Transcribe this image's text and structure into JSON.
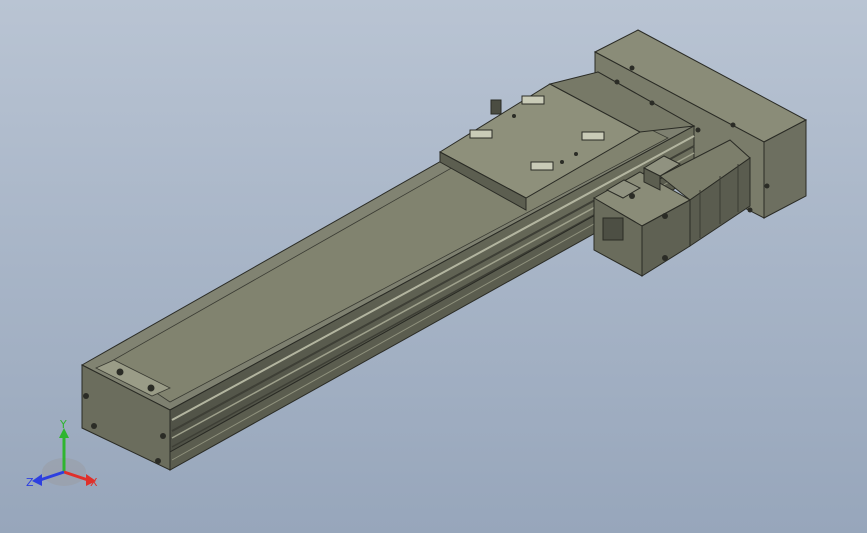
{
  "viewport": {
    "background_top": "#b9c4d3",
    "background_bottom": "#97a6bb"
  },
  "model": {
    "body_color": "#7b7d6a",
    "highlight_color": "#a7a994",
    "shadow_color": "#55574a"
  },
  "triad": {
    "x_label": "X",
    "y_label": "Y",
    "z_label": "Z",
    "x_color": "#e0302a",
    "y_color": "#2fb52f",
    "z_color": "#2d3fe0"
  }
}
